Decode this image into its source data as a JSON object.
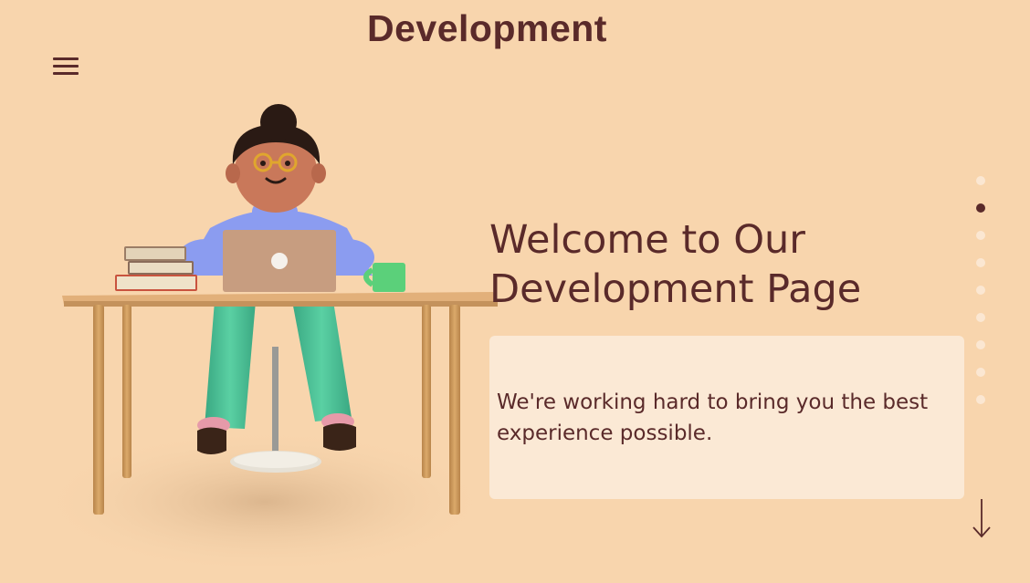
{
  "header": {
    "title": "Development"
  },
  "menu": {
    "icon": "hamburger-menu-icon"
  },
  "hero": {
    "heading_line1": "Welcome to Our",
    "heading_line2": "Development Page",
    "card_text_line1": "We're working hard to bring you the best",
    "card_text_line2": "experience possible."
  },
  "pagination": {
    "count": 9,
    "active_index": 1
  },
  "scroll": {
    "icon": "arrow-down-icon"
  },
  "colors": {
    "background": "#f8d5ad",
    "accent": "#5a2a2a",
    "card": "#fbe9d5"
  }
}
